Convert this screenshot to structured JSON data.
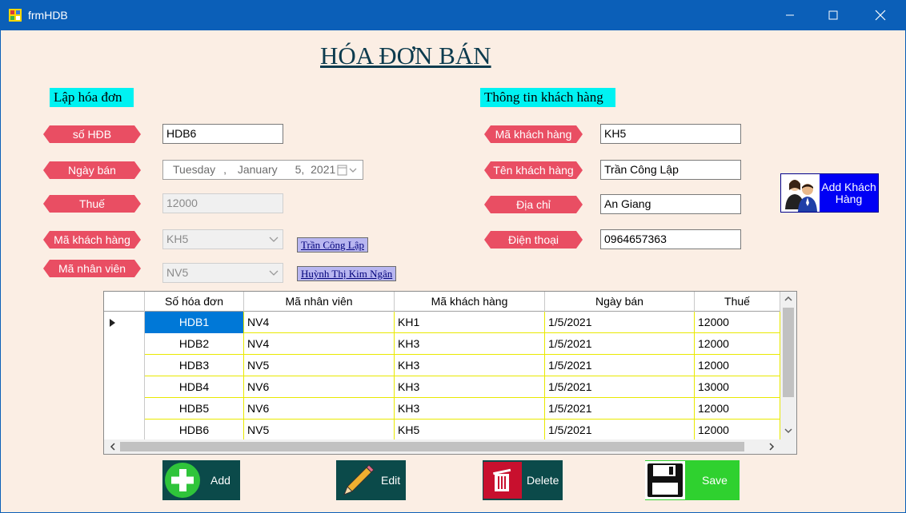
{
  "window": {
    "title": "frmHDB"
  },
  "heading": "HÓA ĐƠN BÁN",
  "sections": {
    "invoice": "Lập hóa đơn",
    "customer": "Thông tin khách hàng"
  },
  "invoice": {
    "so_hdb_label": "số HĐB",
    "so_hdb_value": "HDB6",
    "ngay_ban_label": "Ngày bán",
    "ngay_ban_value": {
      "weekday": "Tuesday",
      "sep1": ",",
      "month": "January",
      "day": "5,",
      "year": "2021"
    },
    "thue_label": "Thuế",
    "thue_value": "12000",
    "ma_kh_label": "Mã khách hàng",
    "ma_kh_value": "KH5",
    "ma_kh_name": "Trần Công Lập",
    "ma_nv_label": "Mã nhân viên",
    "ma_nv_value": "NV5",
    "ma_nv_name": "Huỳnh Thị Kim Ngân"
  },
  "customer": {
    "ma_kh_label": "Mã khách hàng",
    "ma_kh_value": "KH5",
    "ten_kh_label": "Tên khách hàng",
    "ten_kh_value": "Trần Công Lập",
    "dia_chi_label": "Địa chỉ",
    "dia_chi_value": "An Giang",
    "dien_thoai_label": "Điện thoại",
    "dien_thoai_value": "0964657363",
    "add_button": "Add Khách Hàng"
  },
  "grid": {
    "columns": [
      "Số hóa đơn",
      "Mã nhân viên",
      "Mã khách hàng",
      "Ngày bán",
      "Thuế"
    ],
    "rows": [
      [
        "HDB1",
        "NV4",
        "KH1",
        "1/5/2021",
        "12000"
      ],
      [
        "HDB2",
        "NV4",
        "KH3",
        "1/5/2021",
        "12000"
      ],
      [
        "HDB3",
        "NV5",
        "KH3",
        "1/5/2021",
        "12000"
      ],
      [
        "HDB4",
        "NV6",
        "KH3",
        "1/5/2021",
        "13000"
      ],
      [
        "HDB5",
        "NV6",
        "KH3",
        "1/5/2021",
        "12000"
      ],
      [
        "HDB6",
        "NV5",
        "KH5",
        "1/5/2021",
        "12000"
      ]
    ]
  },
  "actions": {
    "add": "Add",
    "edit": "Edit",
    "delete": "Delete",
    "save": "Save"
  },
  "colors": {
    "titlebar": "#0b5fb8",
    "form_bg": "#fbeee4",
    "tag": "#e94e63",
    "section": "#00f2f2",
    "add_btn": "#0b7a36",
    "action_dark": "#0b4a4a",
    "save_green": "#2fd12f"
  }
}
